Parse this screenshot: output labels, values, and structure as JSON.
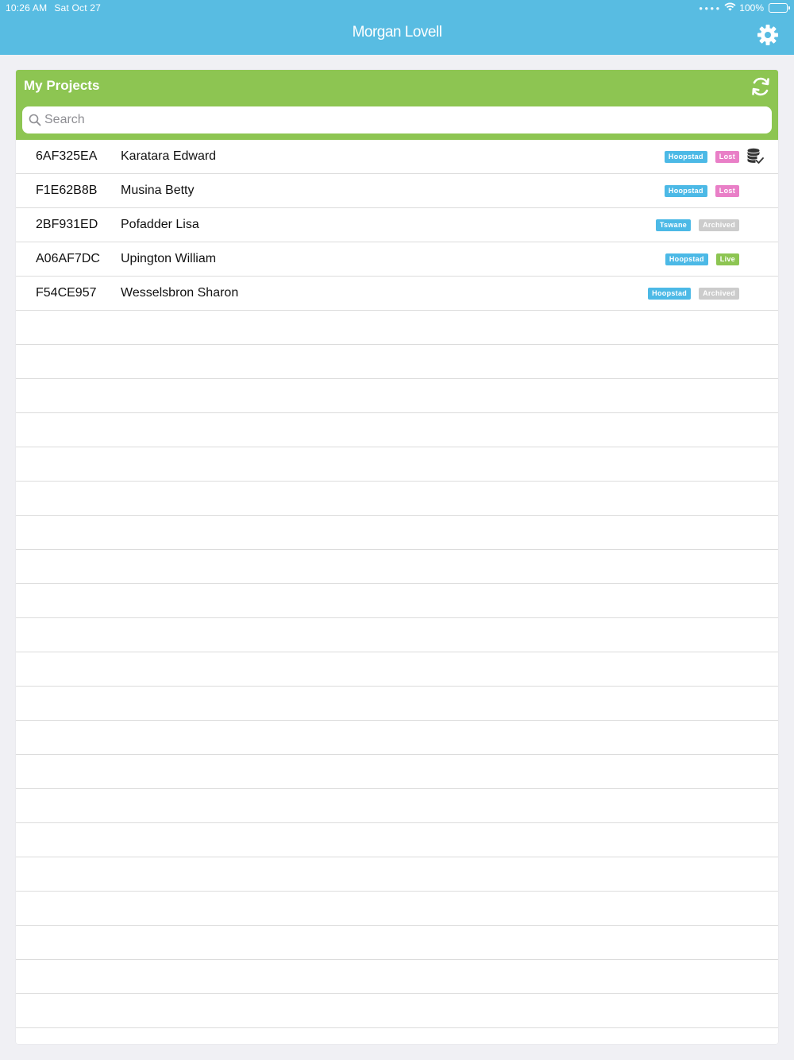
{
  "status_bar": {
    "time": "10:26 AM",
    "date": "Sat Oct 27",
    "battery": "100%"
  },
  "header": {
    "title": "Morgan Lovell"
  },
  "panel": {
    "title": "My Projects",
    "search_placeholder": "Search"
  },
  "colors": {
    "header": "#58bce2",
    "panel_header": "#8dc552",
    "region_badge": "#4cb9e6",
    "lost": "#e97fc7",
    "live": "#8dc552",
    "archived": "#cccccc"
  },
  "projects": [
    {
      "code": "6AF325EA",
      "name": "Karatara Edward",
      "region": "Hoopstad",
      "status": "Lost",
      "status_color": "#e97fc7",
      "synced": true
    },
    {
      "code": "F1E62B8B",
      "name": "Musina Betty",
      "region": "Hoopstad",
      "status": "Lost",
      "status_color": "#e97fc7",
      "synced": false
    },
    {
      "code": "2BF931ED",
      "name": "Pofadder Lisa",
      "region": "Tswane",
      "status": "Archived",
      "status_color": "#cccccc",
      "synced": false
    },
    {
      "code": "A06AF7DC",
      "name": "Upington William",
      "region": "Hoopstad",
      "status": "Live",
      "status_color": "#8dc552",
      "synced": false
    },
    {
      "code": "F54CE957",
      "name": "Wesselsbron Sharon",
      "region": "Hoopstad",
      "status": "Archived",
      "status_color": "#cccccc",
      "synced": false
    }
  ]
}
